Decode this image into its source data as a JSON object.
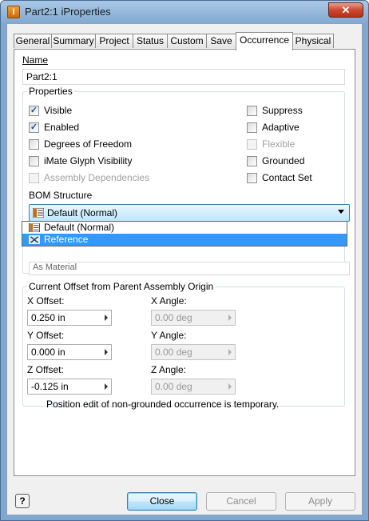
{
  "window": {
    "title": "Part2:1 iProperties",
    "app_icon_letter": "I",
    "close_glyph": "✕"
  },
  "tabs": [
    {
      "label": "General"
    },
    {
      "label": "Summary"
    },
    {
      "label": "Project"
    },
    {
      "label": "Status"
    },
    {
      "label": "Custom"
    },
    {
      "label": "Save"
    },
    {
      "label": "Occurrence"
    },
    {
      "label": "Physical"
    }
  ],
  "active_tab": "Occurrence",
  "name": {
    "label": "Name",
    "value": "Part2:1"
  },
  "properties": {
    "group_label": "Properties",
    "checkboxes": {
      "visible": {
        "label": "Visible",
        "checked": true,
        "enabled": true
      },
      "enabled": {
        "label": "Enabled",
        "checked": true,
        "enabled": true
      },
      "degrees_of_freedom": {
        "label": "Degrees of Freedom",
        "checked": false,
        "enabled": true
      },
      "imate_glyph_visibility": {
        "label": "iMate Glyph Visibility",
        "checked": false,
        "enabled": true
      },
      "assembly_dependencies": {
        "label": "Assembly Dependencies",
        "checked": false,
        "enabled": false
      },
      "suppress": {
        "label": "Suppress",
        "checked": false,
        "enabled": true
      },
      "adaptive": {
        "label": "Adaptive",
        "checked": false,
        "enabled": true
      },
      "flexible": {
        "label": "Flexible",
        "checked": false,
        "enabled": false
      },
      "grounded": {
        "label": "Grounded",
        "checked": false,
        "enabled": true
      },
      "contact_set": {
        "label": "Contact Set",
        "checked": false,
        "enabled": true
      }
    },
    "bom_structure": {
      "label": "BOM Structure",
      "selected": "Default (Normal)",
      "options": [
        "Default (Normal)",
        "Reference"
      ],
      "highlighted": "Reference",
      "obscured_field_text": "As Material"
    }
  },
  "offset": {
    "group_label": "Current Offset from Parent Assembly Origin",
    "x_offset": {
      "label": "X Offset:",
      "value": "0.250 in"
    },
    "y_offset": {
      "label": "Y Offset:",
      "value": "0.000 in"
    },
    "z_offset": {
      "label": "Z Offset:",
      "value": "-0.125 in"
    },
    "x_angle": {
      "label": "X Angle:",
      "value": "0.00 deg"
    },
    "y_angle": {
      "label": "Y Angle:",
      "value": "0.00 deg"
    },
    "z_angle": {
      "label": "Z Angle:",
      "value": "0.00 deg"
    },
    "note": "Position edit of non-grounded occurrence is temporary."
  },
  "buttons": {
    "help": "?",
    "close": "Close",
    "cancel": "Cancel",
    "apply": "Apply"
  },
  "colors": {
    "title_gradient": "#a9c8e6",
    "selection": "#3399ff",
    "combo_border": "#3c7fb1",
    "close_button": "#c84a30"
  }
}
